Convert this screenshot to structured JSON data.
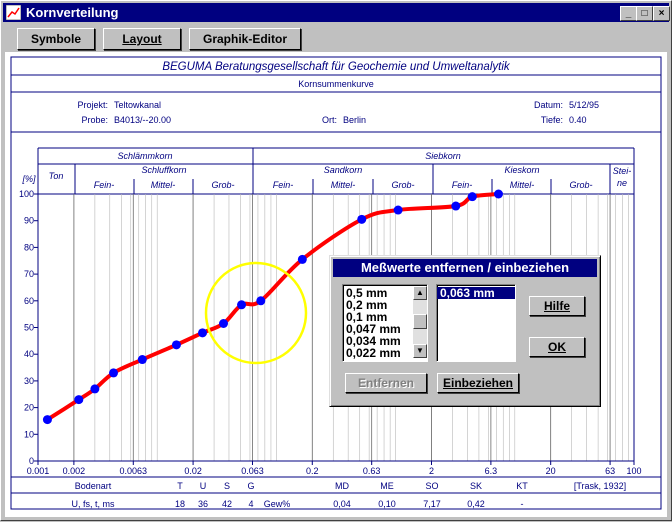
{
  "window": {
    "title": "Kornverteilung",
    "icons": [
      "app-chart-icon",
      "minimize-icon",
      "maximize-icon",
      "close-icon"
    ]
  },
  "toolbar": {
    "symbole": "Symbole",
    "layout": "Layout",
    "graphik": "Graphik-Editor"
  },
  "report": {
    "company": "BEGUMA Beratungsgesellschaft für Geochemie und Umweltanalytik",
    "subtitle": "Kornsummenkurve",
    "projekt_label": "Projekt:",
    "projekt_value": "Teltowkanal",
    "probe_label": "Probe:",
    "probe_value": "B4013/--20.00",
    "ort_label": "Ort:",
    "ort_value": "Berlin",
    "datum_label": "Datum:",
    "datum_value": "5/12/95",
    "tiefe_label": "Tiefe:",
    "tiefe_value": "0.40"
  },
  "grain_classes": {
    "schlaemmkorn": "Schlämmkorn",
    "siebkorn": "Siebkorn",
    "ton": "Ton",
    "schluffkorn": "Schluffkorn",
    "sandkorn": "Sandkorn",
    "kieskorn": "Kieskorn",
    "steine_1": "Stei-",
    "steine_2": "ne",
    "fein": "Fein-",
    "mittel": "Mittel-",
    "grob": "Grob-"
  },
  "chart_data": {
    "type": "line",
    "x_scale": "log",
    "xlim": [
      0.001,
      100
    ],
    "ylim": [
      0,
      100
    ],
    "ylabel": "[%]",
    "x_ticks": [
      "0.001",
      "0.002",
      "0.0063",
      "0.02",
      "0.063",
      "0.2",
      "0.63",
      "2",
      "6.3",
      "20",
      "63",
      "100"
    ],
    "y_ticks": [
      "0",
      "10",
      "20",
      "30",
      "40",
      "50",
      "60",
      "70",
      "80",
      "90",
      "100"
    ],
    "grid": true,
    "line_color": "#ff0000",
    "point_color": "#0000ff",
    "points": [
      {
        "x": 0.0012,
        "y": 15.5
      },
      {
        "x": 0.0022,
        "y": 23
      },
      {
        "x": 0.003,
        "y": 27
      },
      {
        "x": 0.0043,
        "y": 33
      },
      {
        "x": 0.0075,
        "y": 38
      },
      {
        "x": 0.0145,
        "y": 43.5
      },
      {
        "x": 0.024,
        "y": 48
      },
      {
        "x": 0.036,
        "y": 51.5
      },
      {
        "x": 0.051,
        "y": 58.5
      },
      {
        "x": 0.074,
        "y": 60
      },
      {
        "x": 0.165,
        "y": 75.5
      },
      {
        "x": 0.52,
        "y": 90.5
      },
      {
        "x": 1.05,
        "y": 94
      },
      {
        "x": 3.2,
        "y": 95.5
      },
      {
        "x": 4.4,
        "y": 99
      },
      {
        "x": 7.3,
        "y": 100
      }
    ]
  },
  "stats": {
    "header": [
      "Bodenart",
      "T",
      "U",
      "S",
      "G",
      "",
      "MD",
      "ME",
      "SO",
      "SK",
      "KT",
      "[Trask, 1932]"
    ],
    "values": [
      "U, fs, t, ms",
      "18",
      "36",
      "42",
      "4",
      "Gew%",
      "0,04",
      "0,10",
      "7,17",
      "0,42",
      "-",
      ""
    ]
  },
  "dialog": {
    "title": "Meßwerte entfernen / einbeziehen",
    "left_list": [
      "0,5 mm",
      "0,2 mm",
      "0,1 mm",
      "0,047 mm",
      "0,034 mm",
      "0,022 mm"
    ],
    "right_list": [
      "0,063 mm"
    ],
    "entfernen": "Entfernen",
    "einbeziehen": "Einbeziehen",
    "hilfe": "Hilfe",
    "ok": "OK",
    "highlight_color": "#ffff00"
  }
}
